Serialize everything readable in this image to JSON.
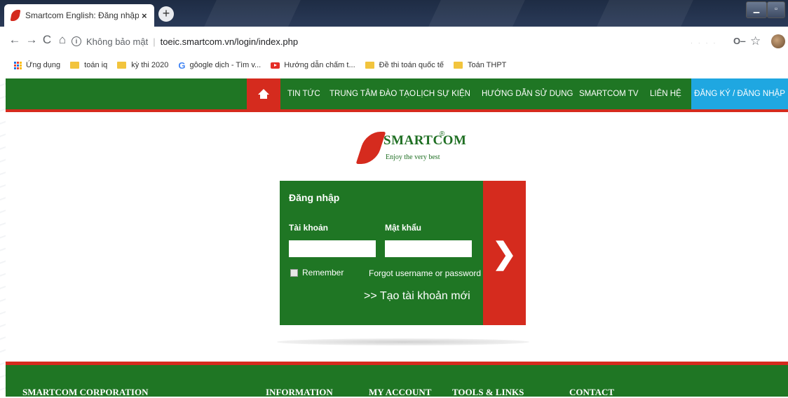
{
  "browser": {
    "tab_title": "Smartcom English: Đăng nhập và",
    "tab_close": "×",
    "new_tab": "+",
    "nav": {
      "back": "←",
      "forward": "→",
      "reload": "C",
      "home": "⌂"
    },
    "security_label": "Không bảo mật",
    "separator": "|",
    "url": "toeic.smartcom.vn/login/index.php",
    "bookmarks": [
      {
        "label": "Ứng dụng",
        "icon": "apps-icon"
      },
      {
        "label": "toán iq",
        "icon": "folder-icon"
      },
      {
        "label": "kỳ thi 2020",
        "icon": "folder-icon"
      },
      {
        "label": "gôogle dịch - Tìm v...",
        "icon": "google-icon"
      },
      {
        "label": "Hướng dẫn chấm t...",
        "icon": "youtube-icon"
      },
      {
        "label": "Đề thi toán quốc tế",
        "icon": "folder-icon"
      },
      {
        "label": "Toán THPT",
        "icon": "folder-icon"
      }
    ]
  },
  "site_nav": {
    "home_icon": "home-icon",
    "items": [
      "TIN TỨC",
      "TRUNG TÂM ĐÀO TẠO",
      "LỊCH SỰ KIỆN",
      "HƯỚNG DẪN SỬ DỤNG",
      "SMARTCOM TV",
      "LIÊN HỆ"
    ],
    "login_register": "ĐĂNG KÝ / ĐĂNG NHẬP"
  },
  "logo": {
    "name": "SMARTCOM",
    "registered": "®",
    "tagline": "Enjoy the very best"
  },
  "login": {
    "title": "Đăng nhập",
    "username_label": "Tài khoản",
    "username_value": "",
    "password_label": "Mật khẩu",
    "password_value": "",
    "remember_label": "Remember",
    "remember_checked": false,
    "forgot_link": "Forgot username or password",
    "create_account": ">> Tạo tài khoản mới",
    "submit_glyph": "❯"
  },
  "footer": {
    "headings": [
      "SMARTCOM CORPORATION",
      "INFORMATION",
      "MY ACCOUNT",
      "TOOLS & LINKS",
      "CONTACT"
    ]
  },
  "colors": {
    "brand_green": "#1f7624",
    "brand_red": "#d52b1e",
    "login_blue": "#1fa7e1"
  }
}
